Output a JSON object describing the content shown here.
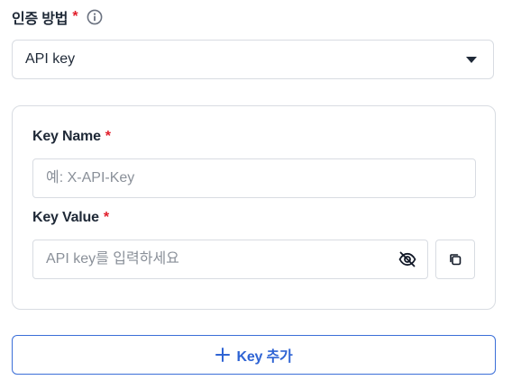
{
  "auth": {
    "label": "인증 방법",
    "required_mark": "*",
    "select_value": "API key"
  },
  "card": {
    "key_name": {
      "label": "Key Name",
      "required_mark": "*",
      "placeholder": "예: X-API-Key",
      "value": ""
    },
    "key_value": {
      "label": "Key Value",
      "required_mark": "*",
      "placeholder": "API key를 입력하세요",
      "value": ""
    }
  },
  "add_button": {
    "label": "Key 추가"
  },
  "icons": {
    "info": "info-icon",
    "dropdown": "chevron-down-icon",
    "visibility": "eye-off-icon",
    "copy": "copy-icon",
    "add": "plus-icon"
  },
  "colors": {
    "required": "#e11d2a",
    "accent": "#2f64d4",
    "border": "#d8dce2",
    "text": "#1f2937"
  }
}
